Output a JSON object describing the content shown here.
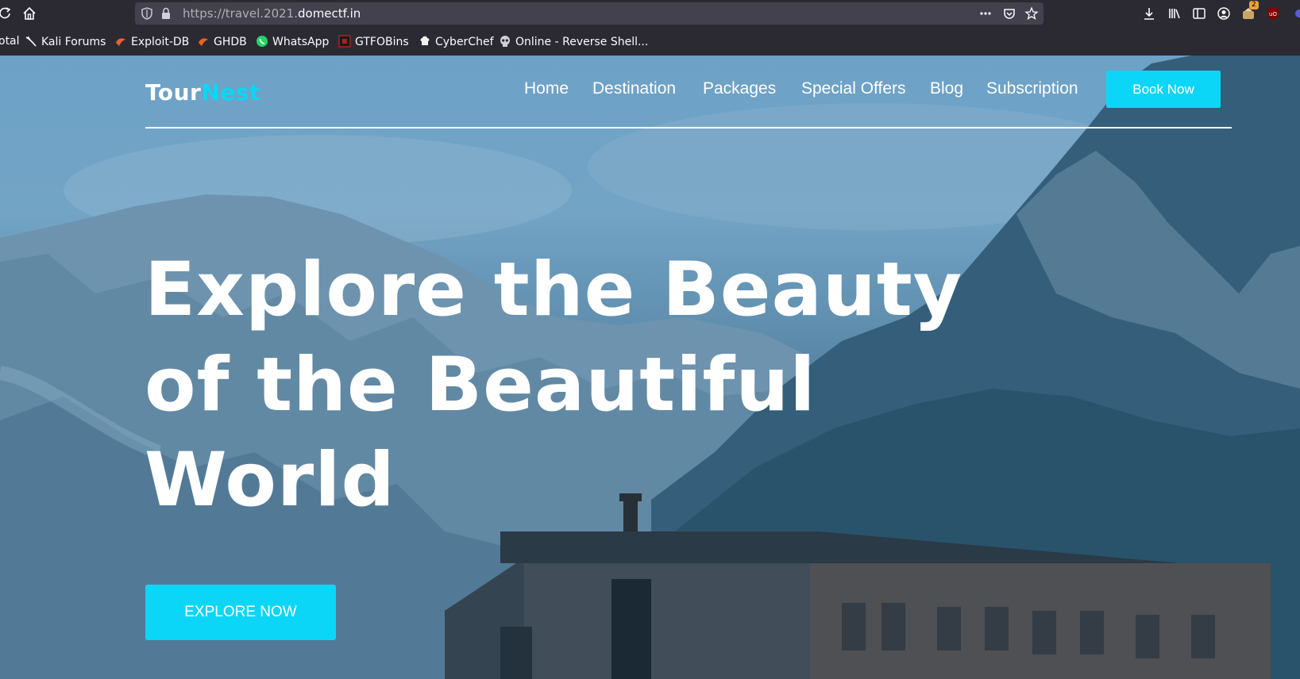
{
  "browser": {
    "url_prefix": "https://travel.2021.",
    "url_domain": "domectf.in",
    "bookmarks": [
      {
        "label": "otal",
        "icon": "none"
      },
      {
        "label": "Kali Forums",
        "icon": "kali-dragon-icon"
      },
      {
        "label": "Exploit-DB",
        "icon": "exploit-db-icon"
      },
      {
        "label": "GHDB",
        "icon": "ghdb-icon"
      },
      {
        "label": "WhatsApp",
        "icon": "whatsapp-icon"
      },
      {
        "label": "GTFOBins",
        "icon": "gtfobins-icon"
      },
      {
        "label": "CyberChef",
        "icon": "cyberchef-icon"
      },
      {
        "label": "Online - Reverse Shell...",
        "icon": "skull-icon"
      }
    ],
    "extension_badge": "2"
  },
  "site": {
    "logo_part1": "Tour",
    "logo_part2": "Nest",
    "nav": [
      "Home",
      "Destination",
      "Packages",
      "Special Offers",
      "Blog",
      "Subscription"
    ],
    "book_button": "Book Now",
    "hero_lines": [
      "Explore the Beauty",
      "of the Beautiful",
      "World"
    ],
    "explore_button": "EXPLORE NOW"
  },
  "colors": {
    "accent": "#0cd6f7",
    "toolbar": "#2b2a33",
    "urlbar": "#42414d"
  }
}
